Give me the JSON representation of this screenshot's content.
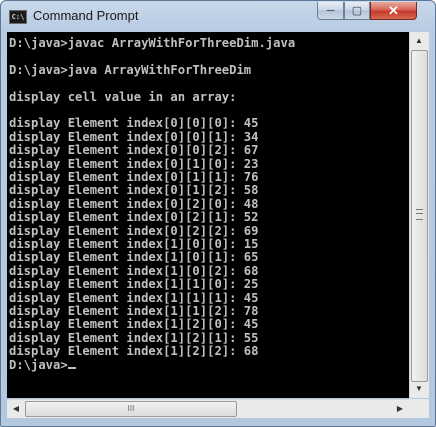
{
  "window": {
    "title": "Command Prompt",
    "icon_text": "C:\\",
    "controls": {
      "minimize": "─",
      "maximize": "▢",
      "close": "✕"
    }
  },
  "console": {
    "lines": [
      "D:\\java>javac ArrayWithForThreeDim.java",
      "",
      "D:\\java>java ArrayWithForThreeDim",
      "",
      "display cell value in an array:",
      "",
      "display Element index[0][0][0]: 45",
      "display Element index[0][0][1]: 34",
      "display Element index[0][0][2]: 67",
      "display Element index[0][1][0]: 23",
      "display Element index[0][1][1]: 76",
      "display Element index[0][1][2]: 58",
      "display Element index[0][2][0]: 48",
      "display Element index[0][2][1]: 52",
      "display Element index[0][2][2]: 69",
      "display Element index[1][0][0]: 15",
      "display Element index[1][0][1]: 65",
      "display Element index[1][0][2]: 68",
      "display Element index[1][1][0]: 25",
      "display Element index[1][1][1]: 45",
      "display Element index[1][1][2]: 78",
      "display Element index[1][2][0]: 45",
      "display Element index[1][2][1]: 55",
      "display Element index[1][2][2]: 68"
    ],
    "prompt": "D:\\java>"
  },
  "scrollbars": {
    "up": "▲",
    "down": "▼",
    "left": "◀",
    "right": "▶",
    "hgrip": "III"
  },
  "colors": {
    "console_bg": "#000000",
    "console_text": "#c0c0c0",
    "title_bar": "#b9cde4",
    "close_button": "#c94a3a"
  }
}
